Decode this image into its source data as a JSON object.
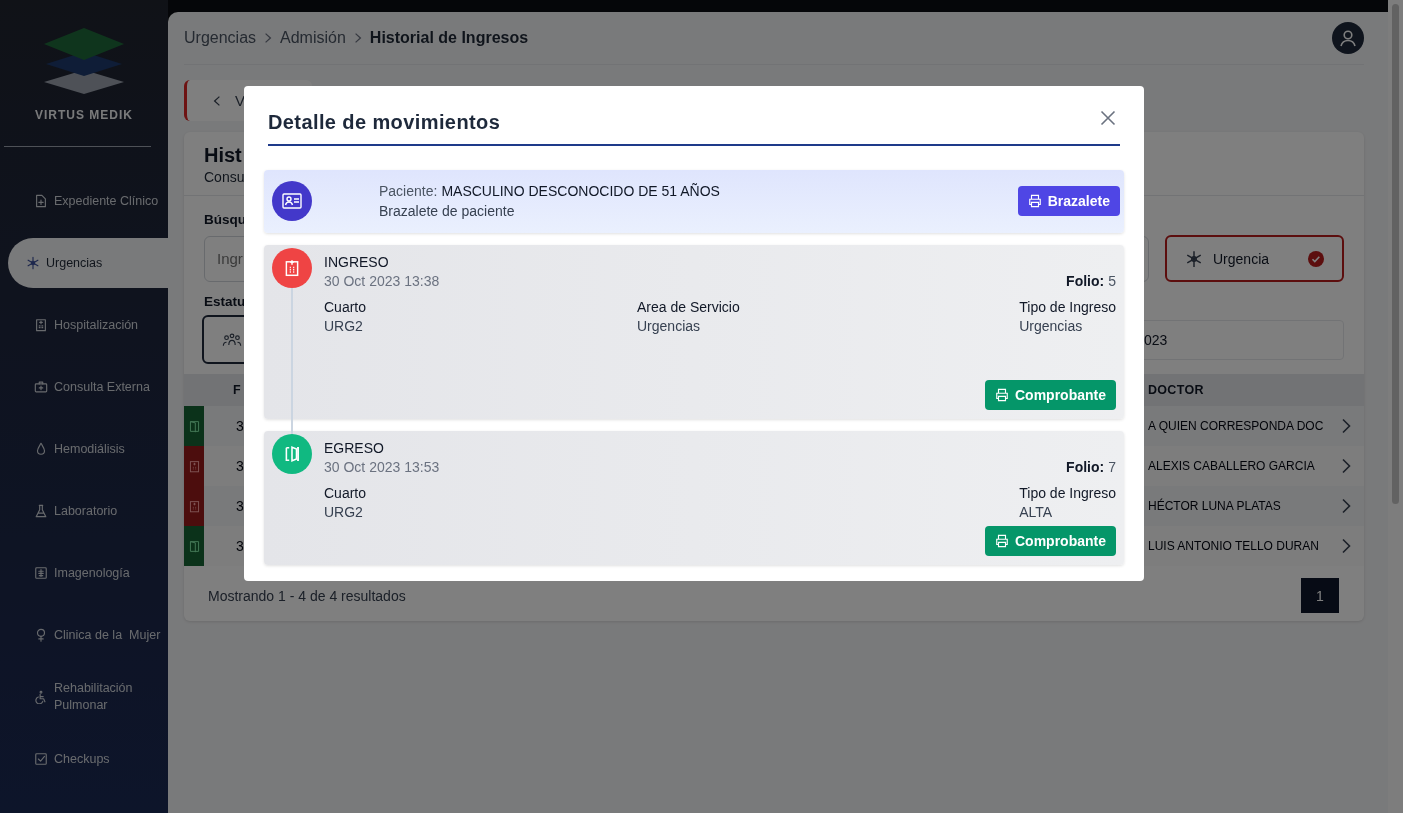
{
  "sidebar": {
    "brand": "VIRTUS MEDIK",
    "items": [
      {
        "label": "Expediente Clínico",
        "kind": "file",
        "selected": false
      },
      {
        "label": "Urgencias",
        "kind": "snowflake",
        "selected": true
      },
      {
        "label": "Hospitalización",
        "kind": "hospital",
        "selected": false
      },
      {
        "label": "Consulta Externa",
        "kind": "clinic",
        "selected": false
      },
      {
        "label": "Hemodiálisis",
        "kind": "droplet",
        "selected": false
      },
      {
        "label": "Laboratorio",
        "kind": "flask",
        "selected": false
      },
      {
        "label": "Imagenología",
        "kind": "xray",
        "selected": false
      },
      {
        "label": "Clinica de la  Mujer",
        "kind": "female",
        "selected": false
      },
      {
        "label": "Rehabilitación Pulmonar",
        "kind": "wheelchair",
        "selected": false
      },
      {
        "label": "Checkups",
        "kind": "checkbox",
        "selected": false
      }
    ]
  },
  "breadcrumb": [
    {
      "label": "Urgencias",
      "current": false
    },
    {
      "label": "Admisión",
      "current": false
    },
    {
      "label": "Historial de Ingresos",
      "current": true
    }
  ],
  "back_button": {
    "label": "V"
  },
  "page": {
    "title": "Hist",
    "subtitle": "Consu"
  },
  "search": {
    "label": "Búsqu",
    "placeholder": "Ingr"
  },
  "type_filter": {
    "label": "Urgencia",
    "selected": true
  },
  "status": {
    "label": "Estatu",
    "selected": true
  },
  "date_field": {
    "value": "023"
  },
  "table": {
    "columns": [
      "F",
      "DOCTOR"
    ],
    "rows": [
      {
        "kind": "egreso",
        "date": "3",
        "doctor": "A QUIEN CORRESPONDA DOC"
      },
      {
        "kind": "ingreso",
        "date": "3",
        "doctor": "ALEXIS CABALLERO GARCIA"
      },
      {
        "kind": "ingreso",
        "date": "3",
        "doctor": "HÉCTOR LUNA PLATAS"
      },
      {
        "kind": "egreso",
        "date": "3",
        "doctor": "LUIS ANTONIO TELLO DURAN"
      }
    ]
  },
  "footer": {
    "summary": "Mostrando 1 - 4 de 4 resultados",
    "pages": [
      {
        "label": "1",
        "selected": true
      }
    ]
  },
  "modal": {
    "title": "Detalle de movimientos",
    "patient": {
      "label": "Paciente:",
      "name": "MASCULINO DESCONOCIDO DE 51 AÑOS",
      "subtitle": "Brazalete de paciente",
      "button": "Brazalete"
    },
    "movements": [
      {
        "kind": "ingreso",
        "title": "INGRESO",
        "date": "30 Oct 2023 13:38",
        "folio_label": "Folio:",
        "folio": "5",
        "room": {
          "label": "Cuarto",
          "value": "URG2"
        },
        "service_area": {
          "label": "Area de Servicio",
          "value": "Urgencias"
        },
        "admission_type": {
          "label": "Tipo de Ingreso",
          "value": "Urgencias"
        },
        "button": "Comprobante"
      },
      {
        "kind": "egreso",
        "title": "EGRESO",
        "date": "30 Oct 2023 13:53",
        "folio_label": "Folio:",
        "folio": "7",
        "room": {
          "label": "Cuarto",
          "value": "URG2"
        },
        "admission_type": {
          "label": "Tipo de Ingreso",
          "value": "ALTA"
        },
        "button": "Comprobante"
      }
    ]
  }
}
